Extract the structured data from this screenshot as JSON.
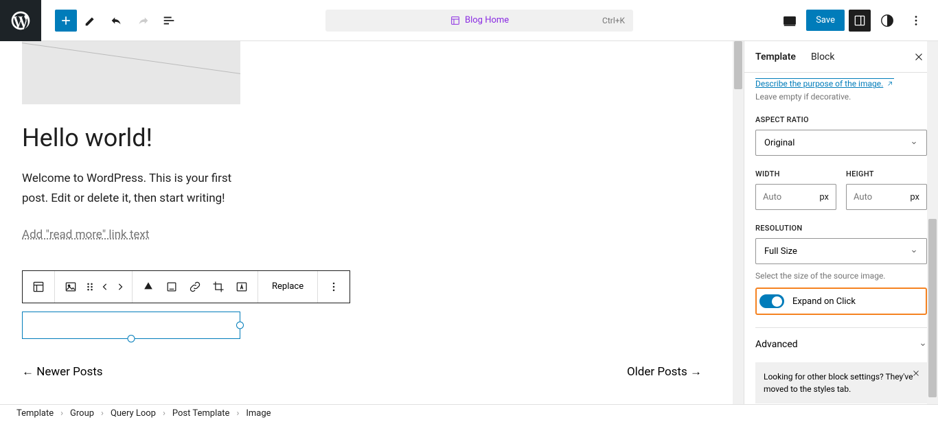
{
  "toolbar": {
    "doc_title": "Blog Home",
    "shortcut": "Ctrl+K",
    "save_label": "Save"
  },
  "canvas": {
    "post_title": "Hello world!",
    "post_body": "Welcome to WordPress. This is your first post. Edit or delete it, then start writing!",
    "read_more_placeholder": "Add \"read more\" link text",
    "replace_label": "Replace",
    "newer_posts": "←   Newer Posts",
    "older_posts": "Older Posts   →"
  },
  "sidebar": {
    "tabs": {
      "template": "Template",
      "block": "Block"
    },
    "alt_link": "Describe the purpose of the image.",
    "alt_hint": "Leave empty if decorative.",
    "aspect_label": "Aspect Ratio",
    "aspect_value": "Original",
    "width_label": "Width",
    "height_label": "Height",
    "dim_placeholder": "Auto",
    "dim_unit": "px",
    "resolution_label": "Resolution",
    "resolution_value": "Full Size",
    "resolution_help": "Select the size of the source image.",
    "expand_label": "Expand on Click",
    "advanced_label": "Advanced",
    "notice_text": "Looking for other block settings? They've moved to the styles tab."
  },
  "breadcrumbs": [
    "Template",
    "Group",
    "Query Loop",
    "Post Template",
    "Image"
  ]
}
